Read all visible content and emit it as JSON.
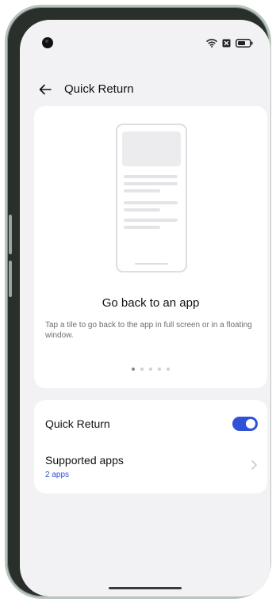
{
  "status_bar": {
    "icons": [
      "camera-cutout",
      "wifi-icon",
      "sim-icon",
      "battery-icon"
    ]
  },
  "header": {
    "title": "Quick Return",
    "back_icon": "back-arrow-icon"
  },
  "intro": {
    "heading": "Go back to an app",
    "description": "Tap a tile to go back to the app in full screen or in a floating window.",
    "page_count": 5,
    "current_page": 1
  },
  "settings": {
    "quick_return": {
      "label": "Quick Return",
      "enabled": true
    },
    "supported_apps": {
      "label": "Supported apps",
      "value": "2 apps"
    }
  },
  "colors": {
    "accent": "#2f52d6",
    "background": "#f2f2f4",
    "card": "#ffffff"
  }
}
